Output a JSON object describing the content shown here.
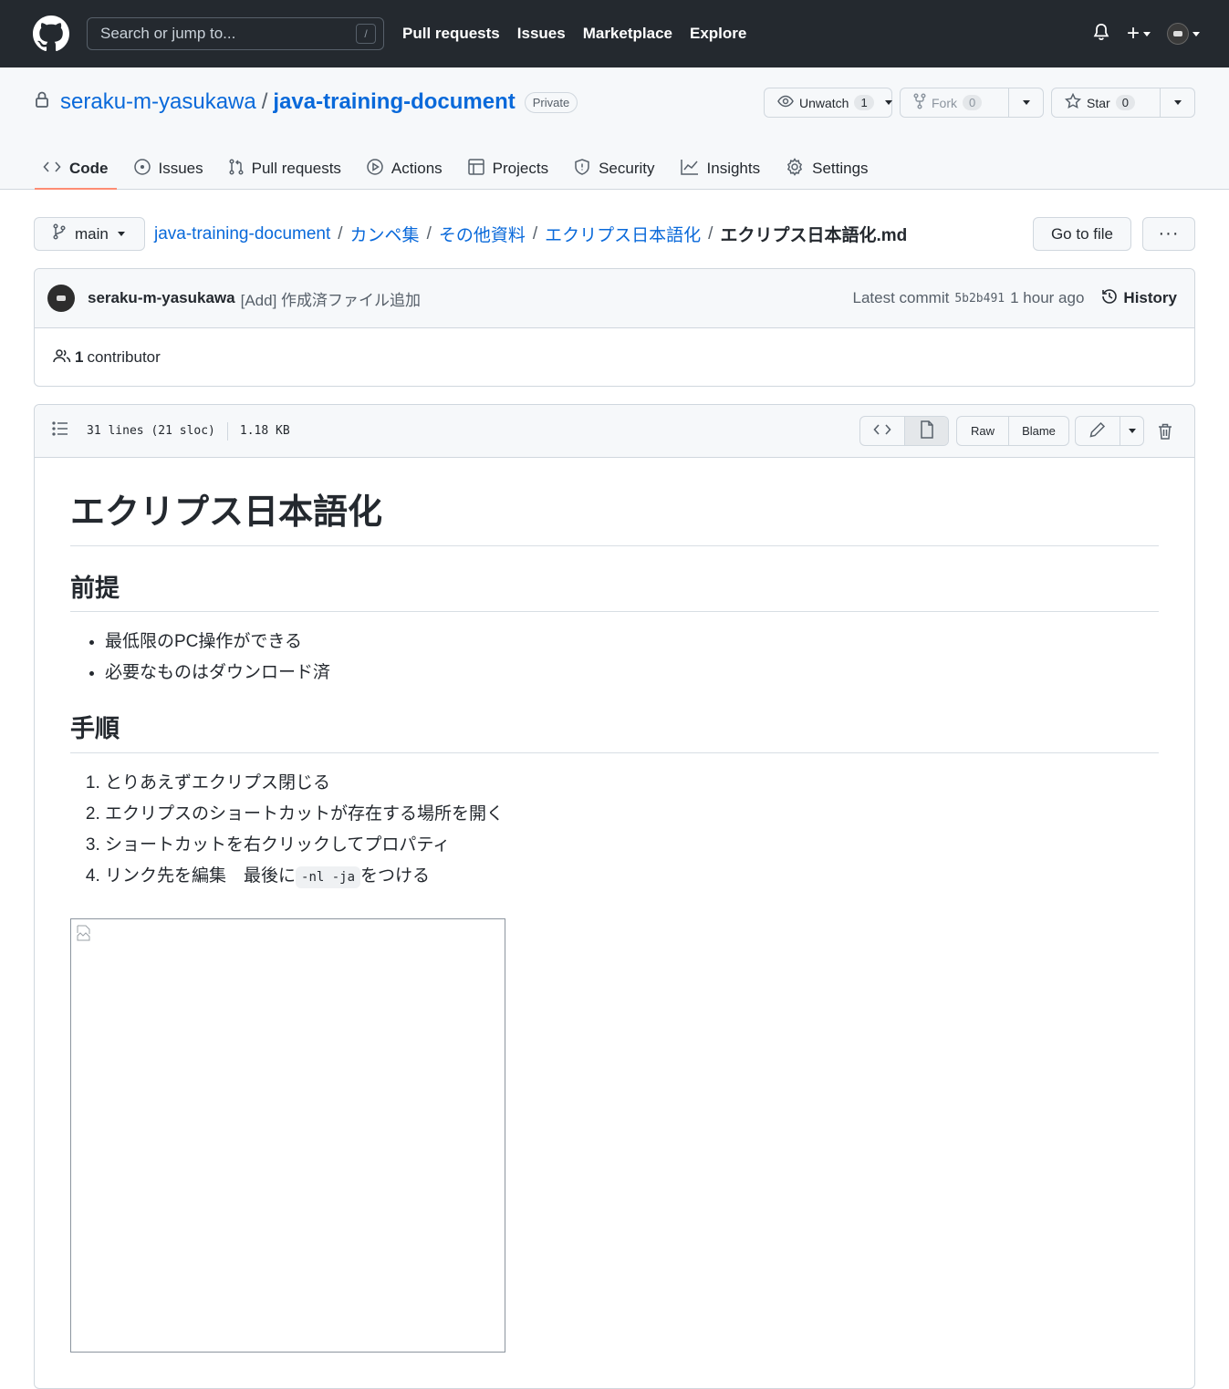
{
  "header": {
    "search_placeholder": "Search or jump to...",
    "search_shortcut": "/",
    "nav": [
      "Pull requests",
      "Issues",
      "Marketplace",
      "Explore"
    ],
    "plus": "+"
  },
  "repo": {
    "owner": "seraku-m-yasukawa",
    "separator": "/",
    "name": "java-training-document",
    "visibility": "Private",
    "unwatch_label": "Unwatch",
    "watch_count": "1",
    "fork_label": "Fork",
    "fork_count": "0",
    "star_label": "Star",
    "star_count": "0"
  },
  "tabs": [
    "Code",
    "Issues",
    "Pull requests",
    "Actions",
    "Projects",
    "Security",
    "Insights",
    "Settings"
  ],
  "breadcrumb": {
    "branch": "main",
    "parts": [
      "java-training-document",
      "カンペ集",
      "その他資料",
      "エクリプス日本語化"
    ],
    "separator": "/",
    "file": "エクリプス日本語化.md",
    "goto_label": "Go to file",
    "more_label": "···"
  },
  "commit": {
    "author": "seraku-m-yasukawa",
    "message": "[Add] 作成済ファイル追加",
    "latest_label": "Latest commit",
    "sha": "5b2b491",
    "time": "1 hour ago",
    "history_label": "History",
    "contributors_count": "1",
    "contributors_label": "contributor"
  },
  "file": {
    "lines": "31 lines (21 sloc)",
    "size": "1.18 KB",
    "raw_label": "Raw",
    "blame_label": "Blame"
  },
  "markdown": {
    "h1": "エクリプス日本語化",
    "section1_title": "前提",
    "section1_items": [
      "最低限のPC操作ができる",
      "必要なものはダウンロード済"
    ],
    "section2_title": "手順",
    "section2_items": [
      "とりあえずエクリプス閉じる",
      "エクリプスのショートカットが存在する場所を開く",
      "ショートカットを右クリックしてプロパティ"
    ],
    "step4_prefix": "リンク先を編集　最後に",
    "step4_code": "-nl -ja",
    "step4_suffix": "をつける"
  },
  "colors": {
    "header_bg": "#24292f",
    "link": "#0969da",
    "tab_underline": "#fd8c73"
  }
}
